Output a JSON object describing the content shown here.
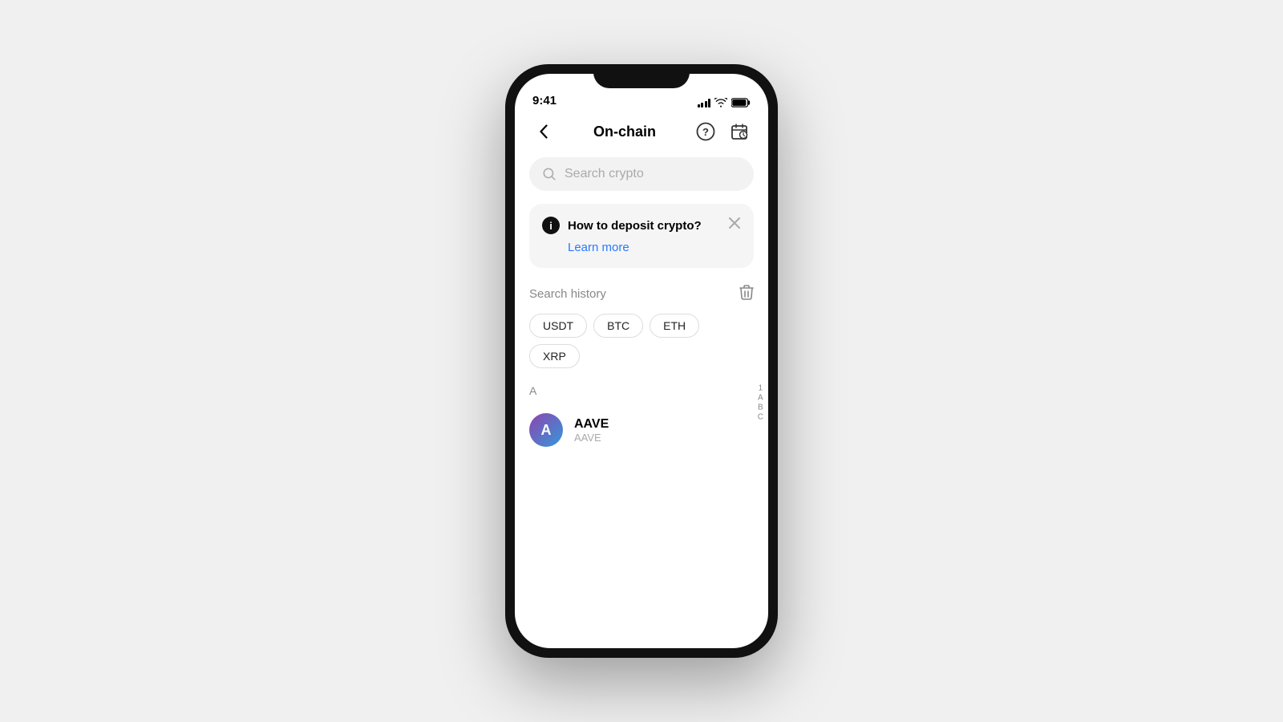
{
  "statusBar": {
    "time": "9:41"
  },
  "header": {
    "title": "On-chain",
    "backLabel": "<",
    "helpLabel": "?",
    "scheduleLabel": "schedule"
  },
  "search": {
    "placeholder": "Search crypto"
  },
  "infoCard": {
    "title": "How to deposit crypto?",
    "learnMore": "Learn more"
  },
  "searchHistory": {
    "label": "Search history",
    "chips": [
      "USDT",
      "BTC",
      "ETH",
      "XRP"
    ]
  },
  "alphabetSection": {
    "letter": "A"
  },
  "coins": [
    {
      "name": "AAVE",
      "symbol": "AAVE",
      "iconLetter": "A",
      "iconGradient": "linear-gradient(135deg, #8e44ad, #4a90d9)"
    }
  ],
  "alphaSidebar": [
    "1",
    "A",
    "B",
    "C"
  ]
}
